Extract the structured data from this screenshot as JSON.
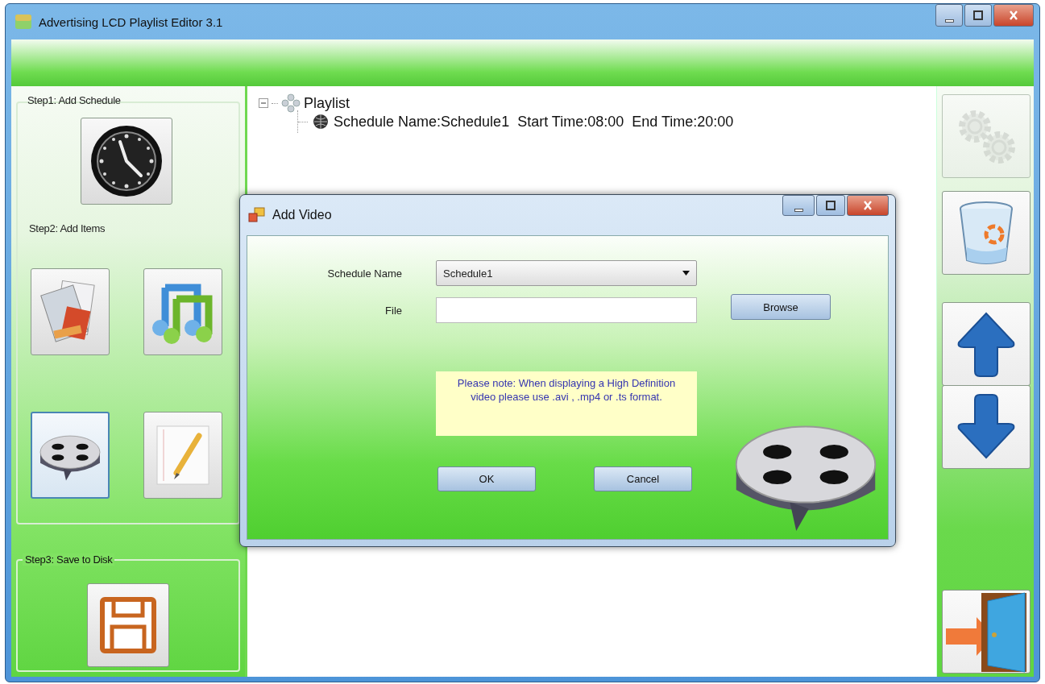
{
  "window": {
    "title": "Advertising LCD Playlist Editor 3.1"
  },
  "steps": [
    {
      "label": "Step1: Add Schedule"
    },
    {
      "label": "Step2: Add Items"
    },
    {
      "label": "Step3: Save to Disk"
    }
  ],
  "item_buttons": [
    {
      "kind": "picture",
      "selected": false
    },
    {
      "kind": "music",
      "selected": false
    },
    {
      "kind": "video",
      "selected": true
    },
    {
      "kind": "text",
      "selected": false
    }
  ],
  "tree": {
    "label": "Playlist",
    "expanded": true,
    "children": [
      {
        "label": "Schedule Name:Schedule1  Start Time:08:00  End Time:20:00"
      }
    ]
  },
  "tools": [
    {
      "kind": "settings",
      "disabled": true
    },
    {
      "kind": "delete",
      "disabled": false
    },
    {
      "kind": "up",
      "disabled": false
    },
    {
      "kind": "down",
      "disabled": false
    },
    {
      "kind": "exit",
      "disabled": false
    }
  ],
  "dialog": {
    "title": "Add Video",
    "schedule_name": {
      "label": "Schedule Name",
      "value": "Schedule1"
    },
    "file": {
      "label": "File"
    },
    "browse": "Browse",
    "note": "Please note: When displaying a High Definition video please use .avi , .mp4 or .ts format.",
    "buttons": [
      "OK",
      "Cancel"
    ]
  }
}
